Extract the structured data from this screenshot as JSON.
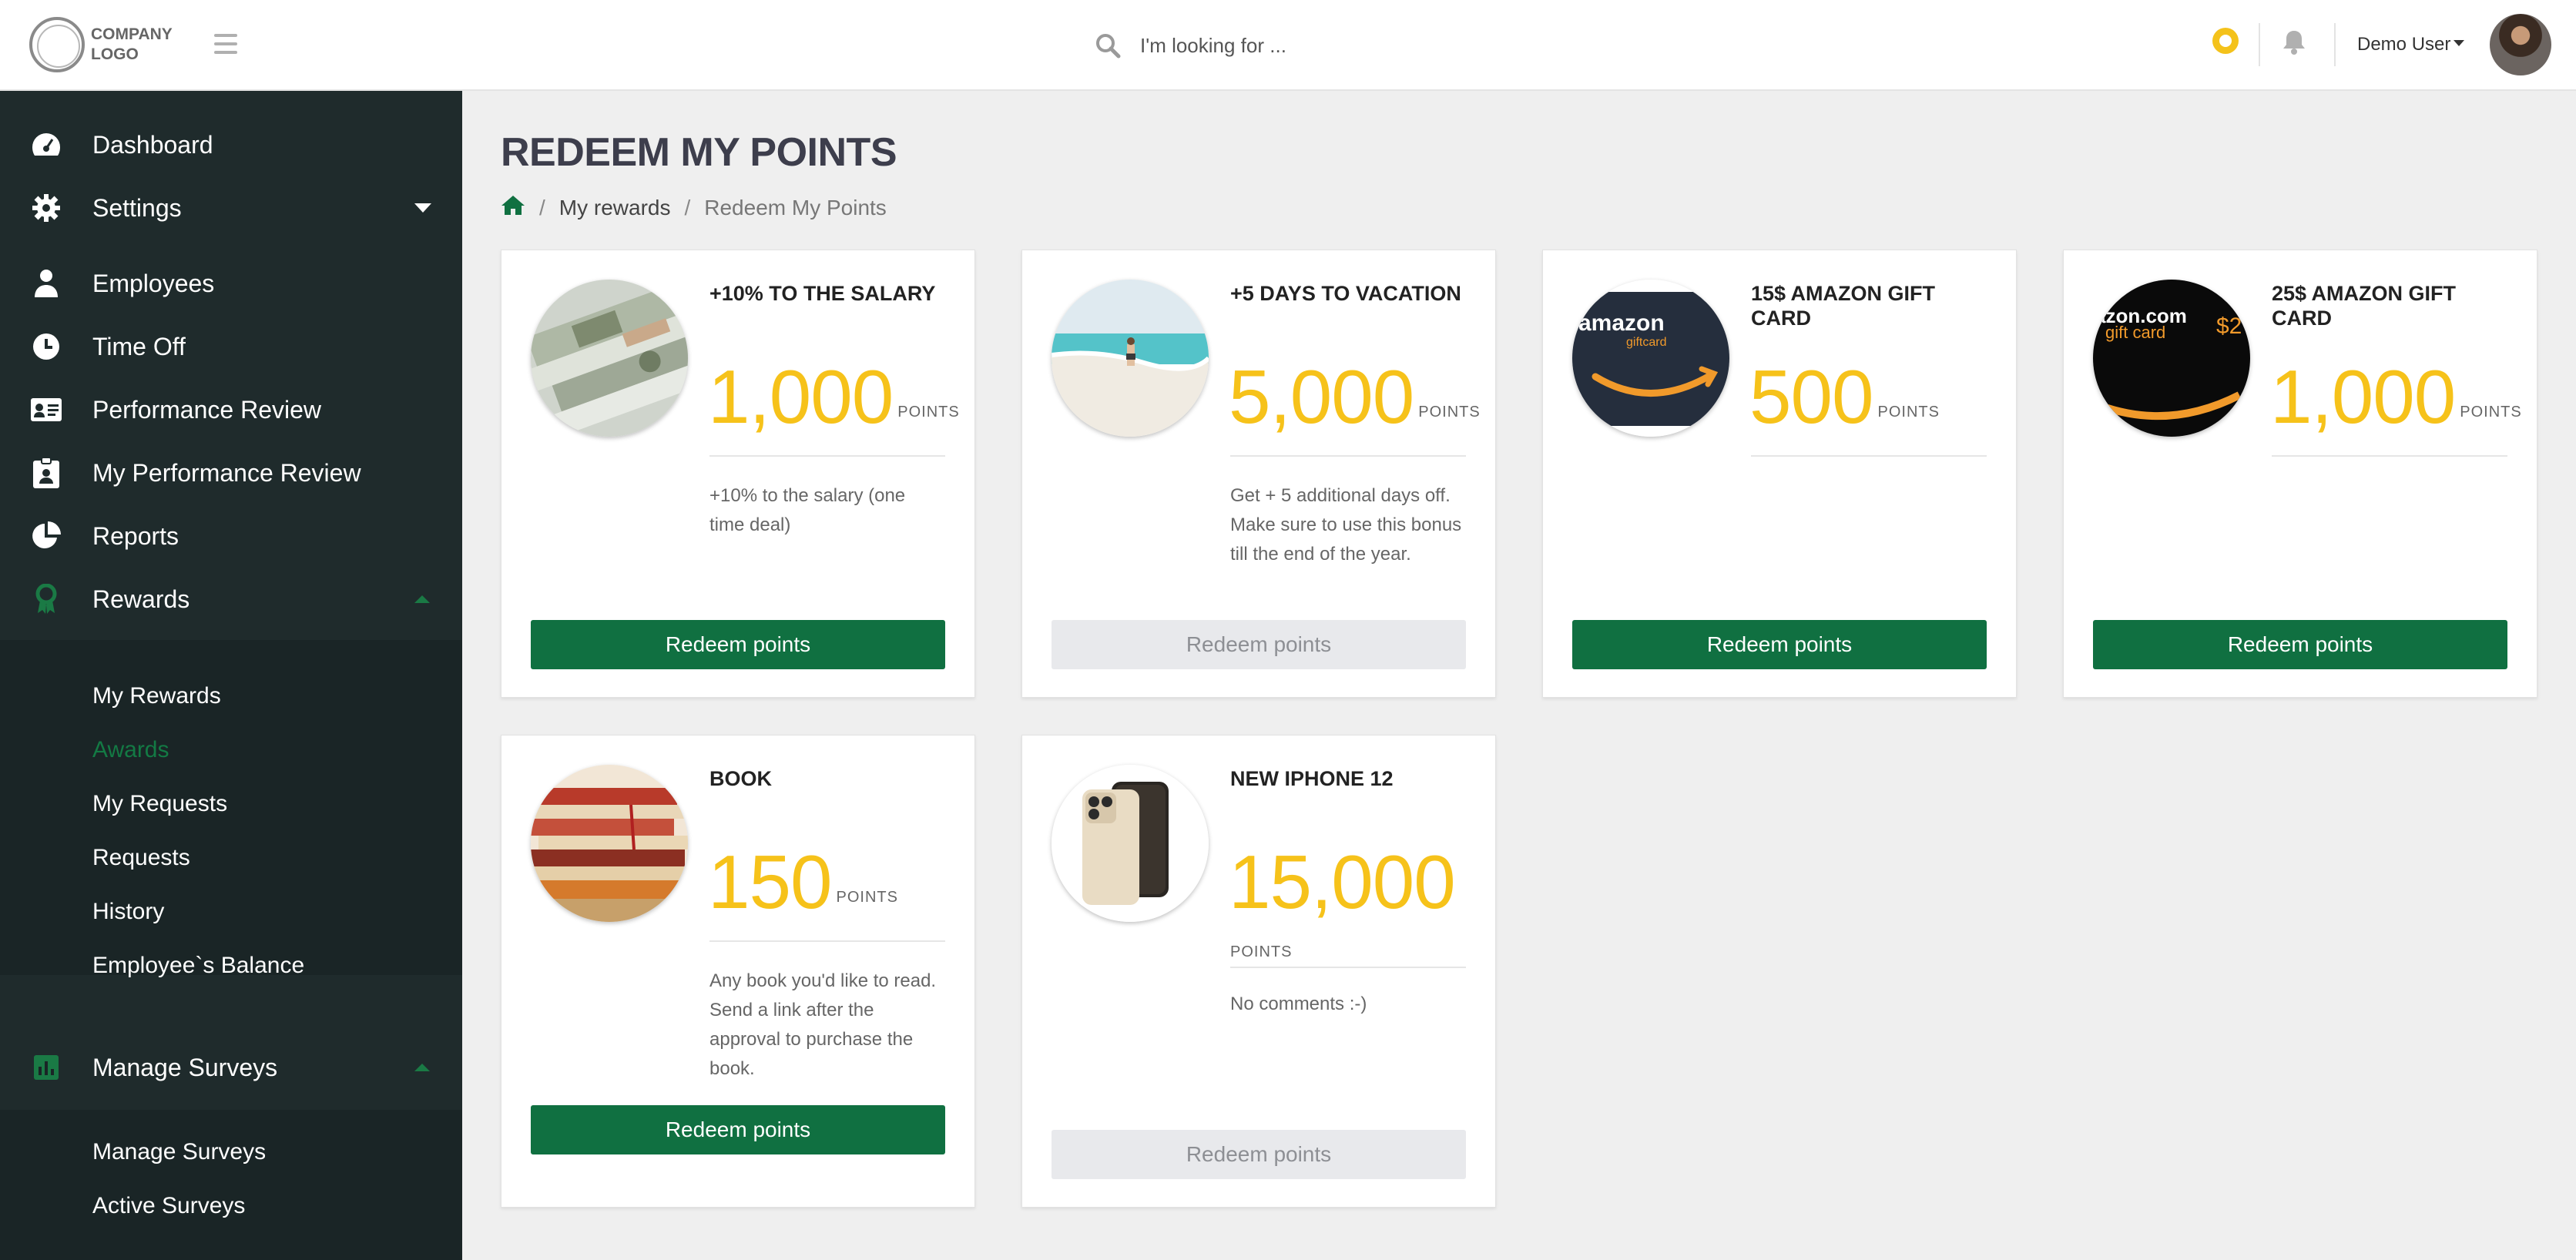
{
  "header": {
    "logo_text": "COMPANY LOGO",
    "search_placeholder": "I'm looking for ...",
    "user_name": "Demo User"
  },
  "sidebar": {
    "items": [
      {
        "label": "Dashboard",
        "icon": "dashboard-icon"
      },
      {
        "label": "Settings",
        "icon": "gear-icon"
      },
      {
        "label": "Employees",
        "icon": "user-icon"
      },
      {
        "label": "Time Off",
        "icon": "clock-icon"
      },
      {
        "label": "Performance Review",
        "icon": "id-card-icon"
      },
      {
        "label": "My Performance Review",
        "icon": "badge-icon"
      },
      {
        "label": "Reports",
        "icon": "pie-chart-icon"
      },
      {
        "label": "Rewards",
        "icon": "award-icon"
      },
      {
        "label": "Manage Surveys",
        "icon": "bar-chart-icon"
      }
    ],
    "rewards_sub": [
      "My Rewards",
      "Awards",
      "My Requests",
      "Requests",
      "History",
      "Employee`s Balance"
    ],
    "surveys_sub": [
      "Manage Surveys",
      "Active Surveys"
    ]
  },
  "main": {
    "title": "REDEEM MY POINTS",
    "breadcrumb": {
      "item1": "My rewards",
      "current": "Redeem My Points"
    },
    "points_label": "POINTS",
    "cards": [
      {
        "title": "+10% TO THE SALARY",
        "points": "1,000",
        "desc": "+10% to the salary (one time deal)",
        "button": "Redeem points",
        "enabled": true,
        "image": "money-stack"
      },
      {
        "title": "+5 DAYS TO VACATION",
        "points": "5,000",
        "desc": "Get + 5 additional days off. Make sure to use this bonus till the end of the year.",
        "button": "Redeem points",
        "enabled": false,
        "image": "beach"
      },
      {
        "title": "15$ AMAZON GIFT CARD",
        "points": "500",
        "desc": "",
        "button": "Redeem points",
        "enabled": true,
        "image": "amazon-gift-card"
      },
      {
        "title": "25$ AMAZON GIFT CARD",
        "points": "1,000",
        "desc": "",
        "button": "Redeem points",
        "enabled": true,
        "image": "amazon-gift-card-25"
      },
      {
        "title": "BOOK",
        "points": "150",
        "desc": "Any book you'd like to read. Send a link after the approval to purchase the book.",
        "button": "Redeem points",
        "enabled": true,
        "image": "books"
      },
      {
        "title": "NEW IPHONE 12",
        "points": "15,000",
        "desc": "No comments :-)",
        "button": "Redeem points",
        "enabled": false,
        "image": "iphone"
      }
    ],
    "amazon_logo_text": "amazon",
    "amazon_logo_text_25": "azon.com",
    "gift_card_text": "giftcard",
    "gift_card_text_25": "gift card",
    "amazon_amount_fragment_25": "$2"
  },
  "colors": {
    "sidebar_bg": "#1f2b2c",
    "accent_green": "#107041",
    "points_yellow": "#f6c21a",
    "disabled_btn": "#e8e9ec"
  }
}
